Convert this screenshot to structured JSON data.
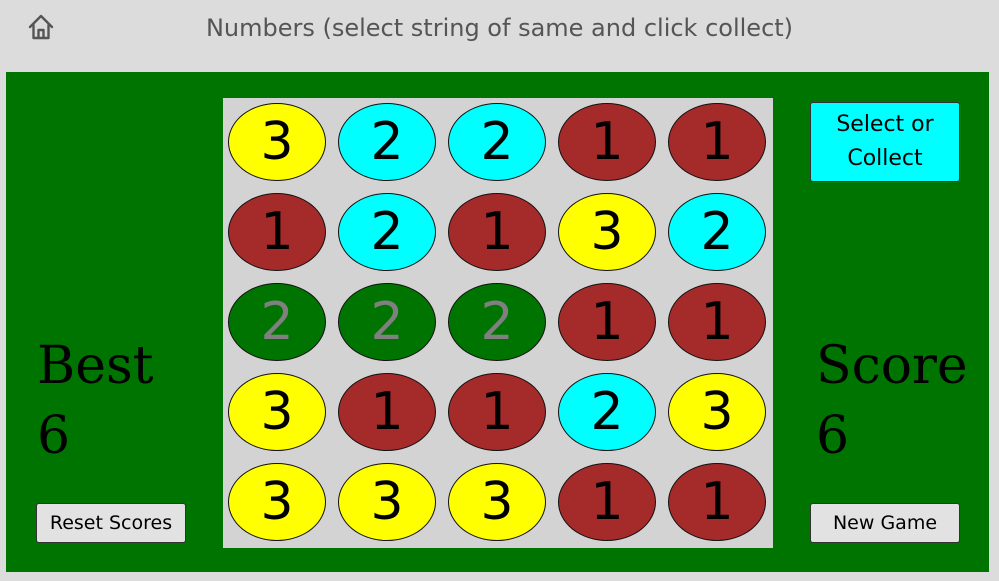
{
  "header": {
    "title": "Numbers (select string of same and click collect)",
    "home_icon": "home-icon"
  },
  "colors": {
    "board": "#007400",
    "grid": "#d3d3d3",
    "yellow": "#ffff00",
    "cyan": "#00ffff",
    "red": "#a52a2a",
    "green_selected": "#007400",
    "selected_text": "#808080"
  },
  "best": {
    "label": "Best",
    "value": "6"
  },
  "score": {
    "label": "Score",
    "value": "6"
  },
  "buttons": {
    "select_collect": "Select or Collect",
    "reset_scores": "Reset Scores",
    "new_game": "New Game"
  },
  "grid": {
    "rows": [
      [
        {
          "value": "3",
          "color": "yellow"
        },
        {
          "value": "2",
          "color": "cyan"
        },
        {
          "value": "2",
          "color": "cyan"
        },
        {
          "value": "1",
          "color": "red"
        },
        {
          "value": "1",
          "color": "red"
        }
      ],
      [
        {
          "value": "1",
          "color": "red"
        },
        {
          "value": "2",
          "color": "cyan"
        },
        {
          "value": "1",
          "color": "red"
        },
        {
          "value": "3",
          "color": "yellow"
        },
        {
          "value": "2",
          "color": "cyan"
        }
      ],
      [
        {
          "value": "2",
          "color": "green_selected",
          "selected": true
        },
        {
          "value": "2",
          "color": "green_selected",
          "selected": true
        },
        {
          "value": "2",
          "color": "green_selected",
          "selected": true
        },
        {
          "value": "1",
          "color": "red"
        },
        {
          "value": "1",
          "color": "red"
        }
      ],
      [
        {
          "value": "3",
          "color": "yellow"
        },
        {
          "value": "1",
          "color": "red"
        },
        {
          "value": "1",
          "color": "red"
        },
        {
          "value": "2",
          "color": "cyan"
        },
        {
          "value": "3",
          "color": "yellow"
        }
      ],
      [
        {
          "value": "3",
          "color": "yellow"
        },
        {
          "value": "3",
          "color": "yellow"
        },
        {
          "value": "3",
          "color": "yellow"
        },
        {
          "value": "1",
          "color": "red"
        },
        {
          "value": "1",
          "color": "red"
        }
      ]
    ]
  }
}
